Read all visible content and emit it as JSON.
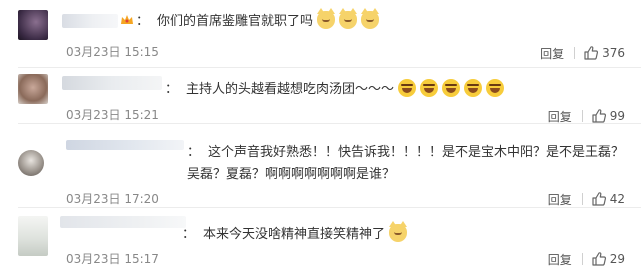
{
  "comments": [
    {
      "text": "你们的首席鉴雕官就职了吗",
      "emojis": [
        "cat-face-icon",
        "cat-face-icon",
        "cat-face-icon"
      ],
      "time": "03月23日 15:15",
      "reply": "回复",
      "likes": "376"
    },
    {
      "text": "主持人的头越看越想吃肉汤团～～～",
      "emojis": [
        "laughing-face-icon",
        "laughing-face-icon",
        "laughing-face-icon",
        "laughing-face-icon",
        "laughing-face-icon"
      ],
      "time": "03月23日 15:21",
      "reply": "回复",
      "likes": "99"
    },
    {
      "text": "这个声音我好熟悉！！快告诉我！！！！是不是宝木中阳？是不是王磊？吴磊？夏磊？啊啊啊啊啊啊啊是谁？",
      "time": "03月23日 17:20",
      "reply": "回复",
      "likes": "42"
    },
    {
      "text": "本来今天没啥精神直接笑精神了",
      "emojis": [
        "cat-face-icon"
      ],
      "time": "03月23日 15:17",
      "reply": "回复",
      "likes": "29"
    }
  ],
  "colors": {
    "text": "#333333",
    "meta": "#888888",
    "separator": "#ececec"
  }
}
